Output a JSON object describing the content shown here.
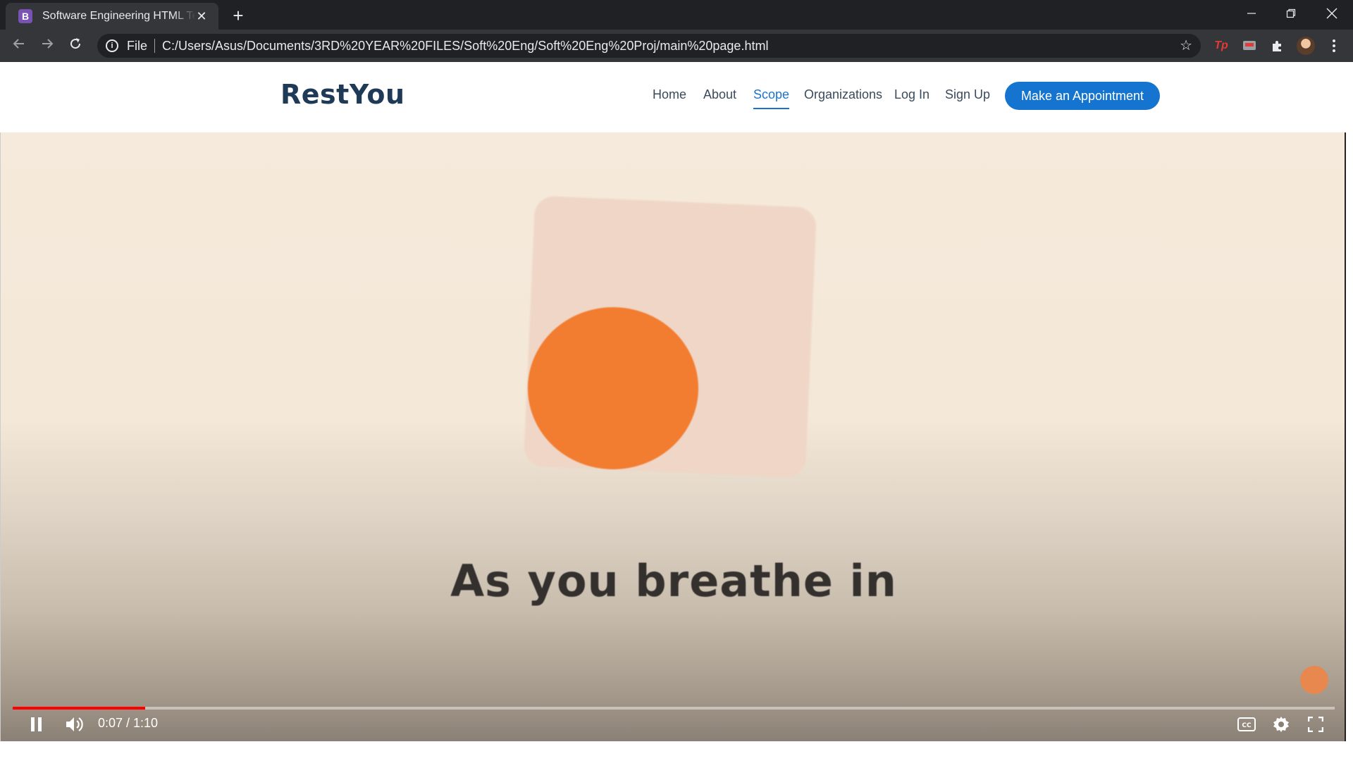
{
  "browser": {
    "tab": {
      "favicon": "B",
      "title": "Software Engineering HTML Tem"
    },
    "url_scheme": "File",
    "url": "C:/Users/Asus/Documents/3RD%20YEAR%20FILES/Soft%20Eng/Soft%20Eng%20Proj/main%20page.html",
    "extension_label": "Tp"
  },
  "site": {
    "brand": "RestYou",
    "nav": [
      {
        "label": "Home"
      },
      {
        "label": "About"
      },
      {
        "label": "Scope",
        "active": true
      },
      {
        "label": "Organizations"
      },
      {
        "label": "Log In"
      },
      {
        "label": "Sign Up"
      }
    ],
    "cta": "Make an Appointment"
  },
  "video": {
    "caption": "As you breathe in",
    "current_time": "0:07",
    "duration": "1:10",
    "time_display": "0:07 / 1:10",
    "progress": 0.1,
    "state": "playing",
    "colors": {
      "accent_circle": "#f27c2f",
      "progress": "#ff0000"
    }
  },
  "icons": [
    "back-icon",
    "forward-icon",
    "reload-icon",
    "info-icon",
    "star-icon",
    "puzzle-icon",
    "pause-icon",
    "volume-icon",
    "captions-icon",
    "settings-icon",
    "fullscreen-icon"
  ]
}
